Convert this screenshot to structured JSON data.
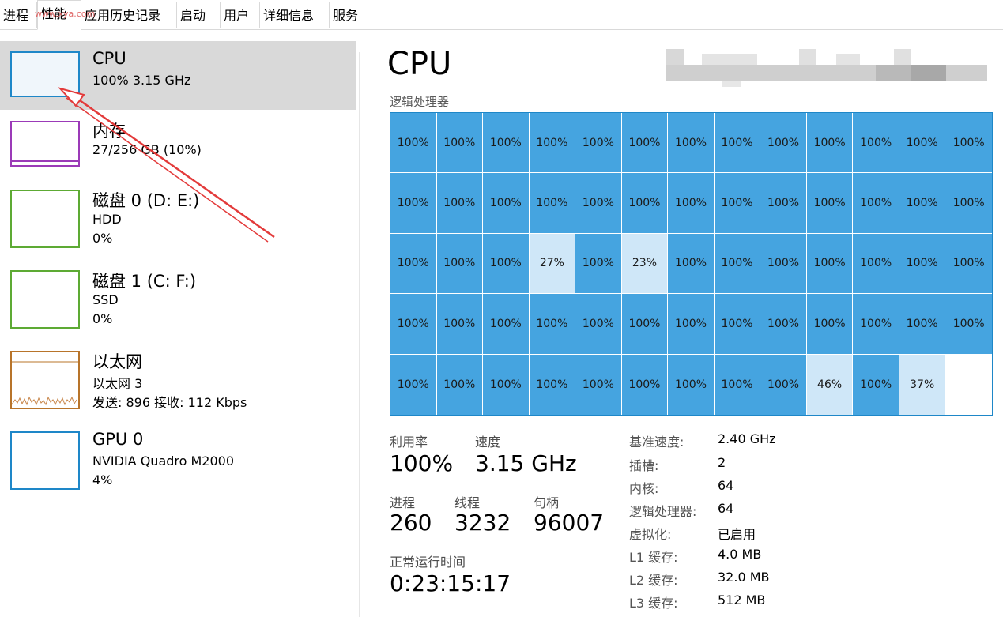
{
  "tabs": [
    {
      "label": "进程",
      "active": false
    },
    {
      "label": "性能",
      "active": true
    },
    {
      "label": "应用历史记录",
      "active": false
    },
    {
      "label": "启动",
      "active": false
    },
    {
      "label": "用户",
      "active": false
    },
    {
      "label": "详细信息",
      "active": false
    },
    {
      "label": "服务",
      "active": false
    }
  ],
  "watermark": "www.xya.com",
  "resources": [
    {
      "title": "CPU",
      "sub1": "100% 3.15 GHz",
      "sub2": "",
      "color": "#1e87c8"
    },
    {
      "title": "内存",
      "sub1": "27/256 GB (10%)",
      "sub2": "",
      "color": "#9b3ab8"
    },
    {
      "title": "磁盘 0 (D: E:)",
      "sub1": "HDD",
      "sub2": "0%",
      "color": "#5daa34"
    },
    {
      "title": "磁盘 1 (C: F:)",
      "sub1": "SSD",
      "sub2": "0%",
      "color": "#5daa34"
    },
    {
      "title": "以太网",
      "sub1": "以太网 3",
      "sub2": "发送: 896 接收: 112 Kbps",
      "color": "#b8742a"
    },
    {
      "title": "GPU 0",
      "sub1": "NVIDIA Quadro M2000",
      "sub2": "4%",
      "color": "#1e87c8"
    }
  ],
  "main": {
    "title": "CPU",
    "grid_label": "逻辑处理器",
    "cores": [
      "100%",
      "100%",
      "100%",
      "100%",
      "100%",
      "100%",
      "100%",
      "100%",
      "100%",
      "100%",
      "100%",
      "100%",
      "100%",
      "100%",
      "100%",
      "100%",
      "100%",
      "100%",
      "100%",
      "100%",
      "100%",
      "100%",
      "100%",
      "100%",
      "100%",
      "100%",
      "100%",
      "100%",
      "100%",
      "27%",
      "100%",
      "23%",
      "100%",
      "100%",
      "100%",
      "100%",
      "100%",
      "100%",
      "100%",
      "100%",
      "100%",
      "100%",
      "100%",
      "100%",
      "100%",
      "100%",
      "100%",
      "100%",
      "100%",
      "100%",
      "100%",
      "100%",
      "100%",
      "100%",
      "100%",
      "100%",
      "100%",
      "100%",
      "100%",
      "100%",
      "100%",
      "46%",
      "100%",
      "37%",
      ""
    ],
    "utilization_label": "利用率",
    "utilization_value": "100%",
    "speed_label": "速度",
    "speed_value": "3.15 GHz",
    "processes_label": "进程",
    "processes_value": "260",
    "threads_label": "线程",
    "threads_value": "3232",
    "handles_label": "句柄",
    "handles_value": "96007",
    "uptime_label": "正常运行时间",
    "uptime_value": "0:23:15:17",
    "specs": [
      {
        "label": "基准速度:",
        "value": "2.40 GHz"
      },
      {
        "label": "插槽:",
        "value": "2"
      },
      {
        "label": "内核:",
        "value": "64"
      },
      {
        "label": "逻辑处理器:",
        "value": "64"
      },
      {
        "label": "虚拟化:",
        "value": "已启用"
      },
      {
        "label": "L1 缓存:",
        "value": "4.0 MB"
      },
      {
        "label": "L2 缓存:",
        "value": "32.0 MB"
      },
      {
        "label": "L3 缓存:",
        "value": "512 MB"
      }
    ]
  },
  "colors": {
    "accent": "#1e87c8",
    "core_full": "#45a4e0",
    "core_low": "#cfe7f8",
    "annotation": "#e33a3a"
  }
}
